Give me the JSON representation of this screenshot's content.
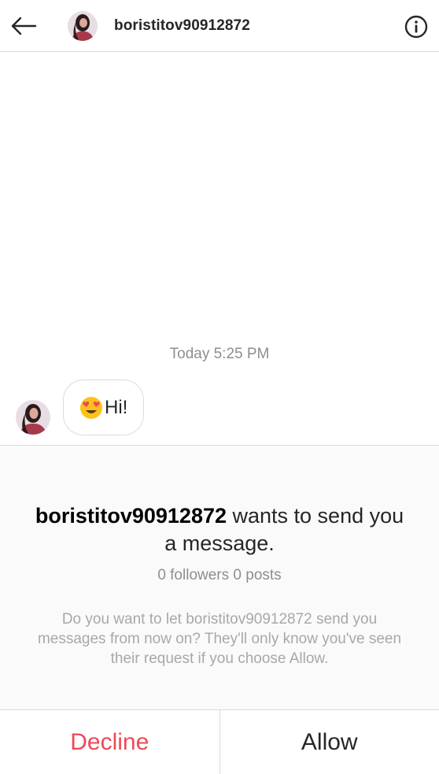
{
  "header": {
    "back_icon": "back-arrow-icon",
    "username": "boristitov90912872",
    "info_icon": "info-icon"
  },
  "thread": {
    "timestamp": "Today 5:25 PM",
    "message": {
      "emoji": "heart-eyes-emoji",
      "text": "Hi!"
    }
  },
  "request": {
    "username": "boristitov90912872",
    "title_rest": " wants to send you a message.",
    "stats": "0 followers 0 posts",
    "description": "Do you want to let boristitov90912872 send you messages from now on? They'll only know you've seen their request if you choose Allow."
  },
  "actions": {
    "decline_label": "Decline",
    "allow_label": "Allow"
  },
  "colors": {
    "decline": "#ed4956",
    "text": "#262626",
    "muted": "#8e8e8e",
    "divider": "#dbdbdb"
  }
}
